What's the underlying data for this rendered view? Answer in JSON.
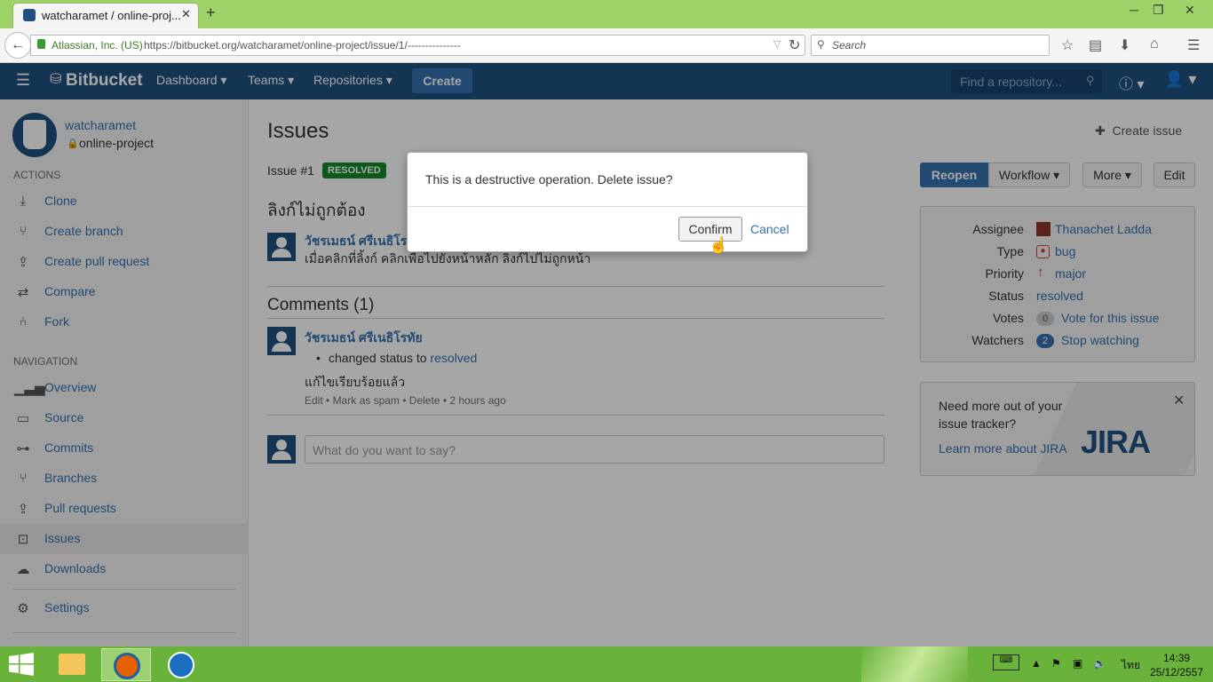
{
  "browser": {
    "tab_title": "watcharamet / online-proj...",
    "site_identity": "Atlassian, Inc. (US)",
    "url": "https://bitbucket.org/watcharamet/online-project/issue/1/---------------",
    "search_placeholder": "Search"
  },
  "header": {
    "logo": "Bitbucket",
    "nav": [
      "Dashboard",
      "Teams",
      "Repositories"
    ],
    "create_label": "Create",
    "find_placeholder": "Find a repository..."
  },
  "sidebar": {
    "owner": "watcharamet",
    "project": "online-project",
    "actions_heading": "ACTIONS",
    "actions": [
      {
        "icon": "download-icon",
        "label": "Clone"
      },
      {
        "icon": "branch-icon",
        "label": "Create branch"
      },
      {
        "icon": "pull-request-icon",
        "label": "Create pull request"
      },
      {
        "icon": "compare-icon",
        "label": "Compare"
      },
      {
        "icon": "fork-icon",
        "label": "Fork"
      }
    ],
    "navigation_heading": "NAVIGATION",
    "navigation": [
      {
        "icon": "bar-chart-icon",
        "label": "Overview"
      },
      {
        "icon": "source-icon",
        "label": "Source"
      },
      {
        "icon": "commit-icon",
        "label": "Commits"
      },
      {
        "icon": "branch-icon",
        "label": "Branches"
      },
      {
        "icon": "pull-request-icon",
        "label": "Pull requests"
      },
      {
        "icon": "issue-icon",
        "label": "Issues"
      },
      {
        "icon": "cloud-download-icon",
        "label": "Downloads"
      }
    ],
    "settings_label": "Settings"
  },
  "main": {
    "title": "Issues",
    "create_issue": "Create issue",
    "issue_number": "Issue #1",
    "status_badge": "RESOLVED",
    "issue_title": "ลิงก์ไม่ถูกต้อง",
    "reporter": "วัชรเมธน์ ศรีเนธิโร",
    "description": "เมื่อคลิกที่ลิ้งก์ คลิกเพื่อไปยังหน้าหลัก ลิงก์ไปไม่ถูกหน้า",
    "comments_heading": "Comments (1)",
    "comment": {
      "author": "วัชรเมธน์ ศรีเนธิโรทัย",
      "change_prefix": "changed status to",
      "change_value": "resolved",
      "text": "แก้ไขเรียบร้อยแล้ว",
      "actions": [
        "Edit",
        "Mark as spam",
        "Delete"
      ],
      "time": "2 hours ago"
    },
    "reply_placeholder": "What do you want to say?"
  },
  "buttons": {
    "reopen": "Reopen",
    "workflow": "Workflow",
    "more": "More",
    "edit": "Edit"
  },
  "meta": {
    "assignee_label": "Assignee",
    "assignee": "Thanachet Ladda",
    "type_label": "Type",
    "type": "bug",
    "priority_label": "Priority",
    "priority": "major",
    "status_label": "Status",
    "status": "resolved",
    "votes_label": "Votes",
    "votes_count": "0",
    "votes_action": "Vote for this issue",
    "watchers_label": "Watchers",
    "watchers_count": "2",
    "watchers_action": "Stop watching"
  },
  "jira_promo": {
    "text": "Need more out of your issue tracker?",
    "link": "Learn more about JIRA",
    "logo": "JIRA"
  },
  "dialog": {
    "message": "This is a destructive operation. Delete issue?",
    "confirm": "Confirm",
    "cancel": "Cancel"
  },
  "taskbar": {
    "language": "ไทย",
    "time": "14:39",
    "date": "25/12/2557"
  },
  "colors": {
    "bitbucket_blue": "#205081",
    "link_blue": "#3572b0",
    "resolved_green": "#14892c",
    "taskbar_green": "#6ab33a"
  }
}
